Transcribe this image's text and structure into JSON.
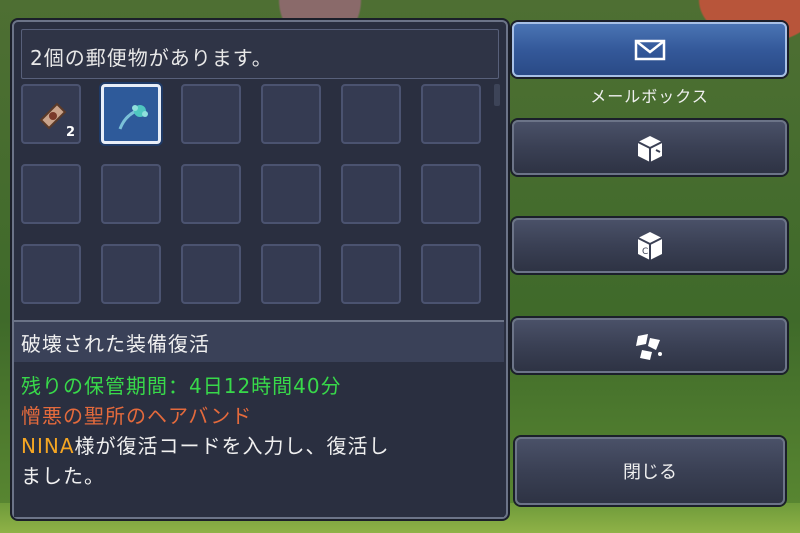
{
  "mailbox": {
    "header": "2個の郵便物があります。",
    "slots": [
      {
        "icon": "scroll-icon",
        "qty": "2"
      },
      {
        "icon": "hairband-icon",
        "qty": ""
      },
      {},
      {},
      {},
      {},
      {},
      {},
      {},
      {},
      {},
      {},
      {},
      {},
      {},
      {},
      {},
      {}
    ]
  },
  "detail": {
    "title": "破壊された装備復活",
    "storage": "残りの保管期間：4日12時間40分",
    "item_name": "憎悪の聖所のヘアバンド",
    "player": "NINA",
    "message_1": "様が復活コードを入力し、復活し",
    "message_2": "ました。"
  },
  "buttons": {
    "mailbox_caption": "メールボックス",
    "close": "閉じる"
  },
  "colors": {
    "storage": "#38d94a",
    "item_name": "#e46a3c",
    "player": "#f5a623"
  }
}
